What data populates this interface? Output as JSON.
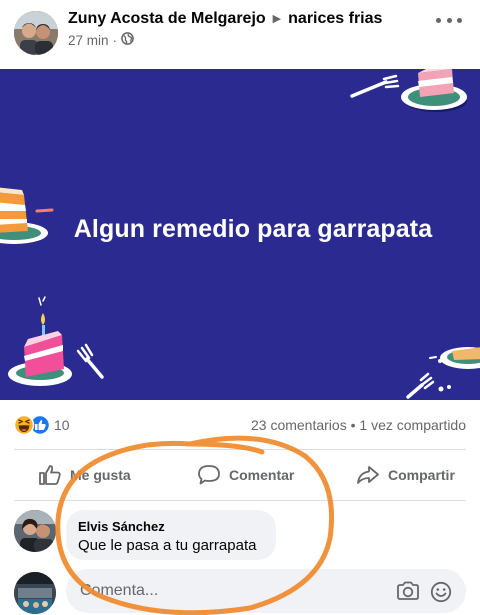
{
  "post": {
    "author": "Zuny Acosta de Melgarejo",
    "group": "narices frias",
    "time": "27 min",
    "privacy_icon": "globe-icon",
    "title": "Algun remedio para garrapata",
    "background_color": "#2a2a90"
  },
  "stats": {
    "reaction_icons": [
      "haha-icon",
      "like-icon"
    ],
    "reactions_count": "10",
    "comments": "23 comentarios",
    "separator": "•",
    "shares": "1 vez compartido"
  },
  "actions": {
    "like": "Me gusta",
    "comment": "Comentar",
    "share": "Compartir"
  },
  "comment": {
    "author": "Elvis Sánchez",
    "text": "Que le pasa a tu garrapata"
  },
  "composer": {
    "placeholder": "Comenta..."
  },
  "colors": {
    "accent": "#1877f2",
    "annotation": "#f08a2c",
    "muted": "#65676b"
  }
}
